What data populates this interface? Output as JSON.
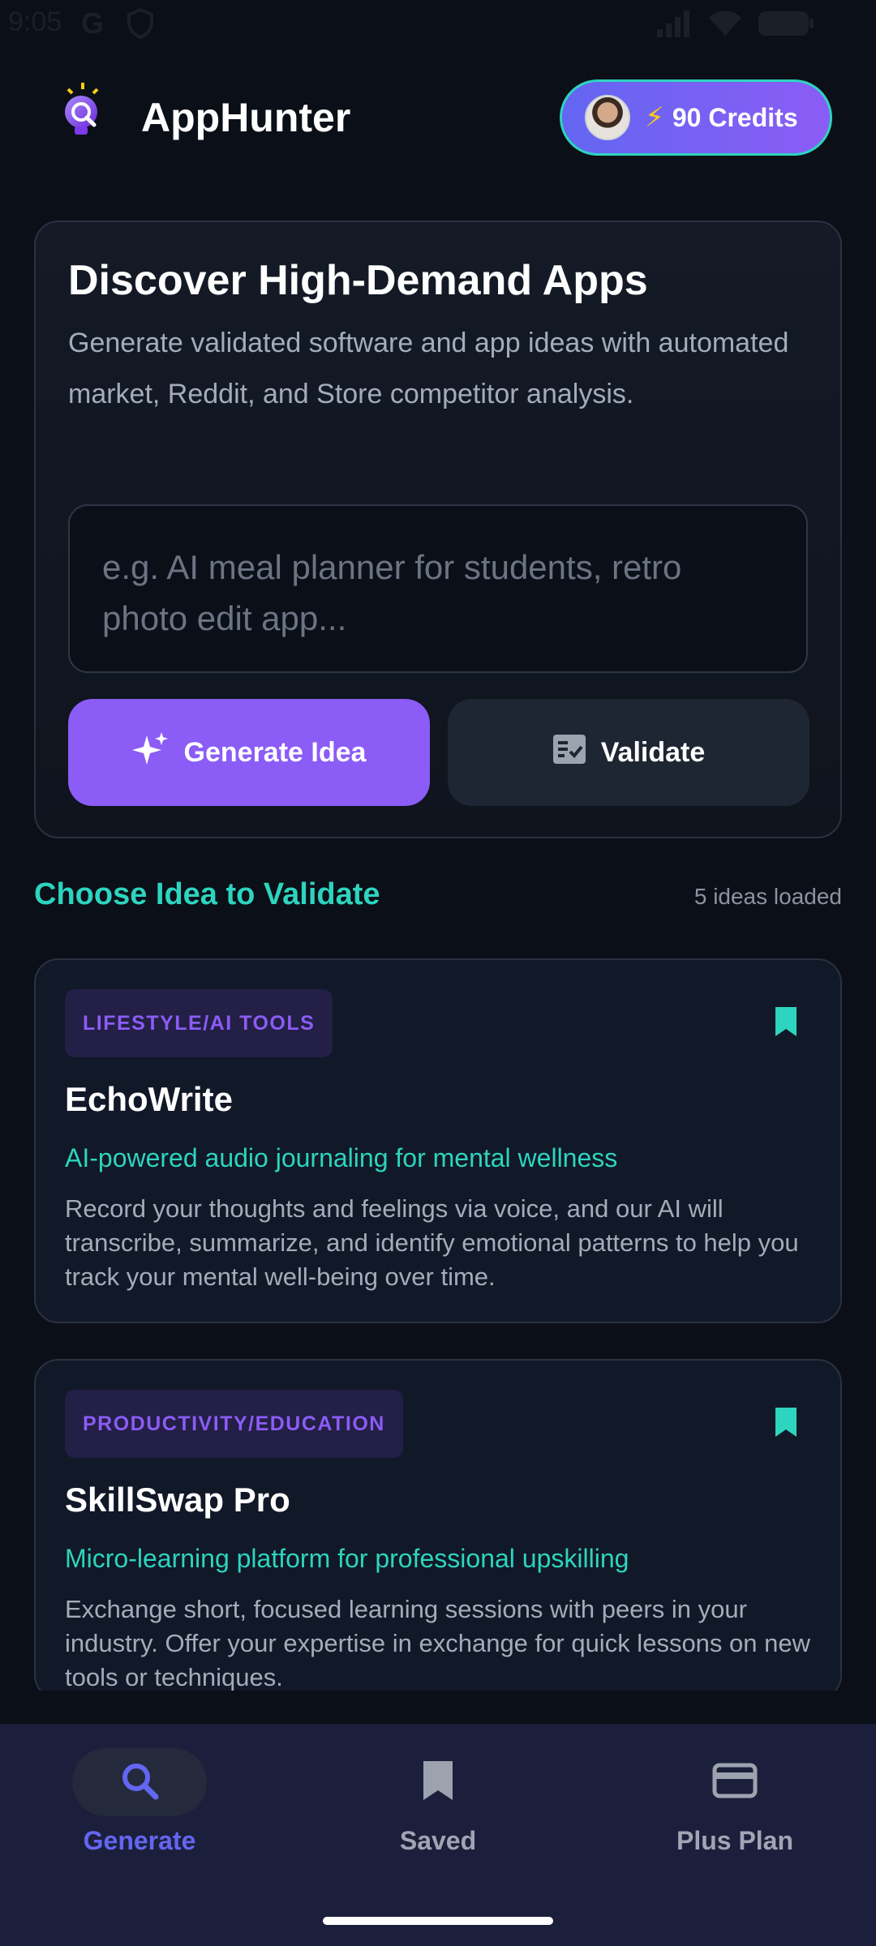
{
  "status_bar": {
    "time": "9:05",
    "carrier_icon": "G"
  },
  "header": {
    "app_title": "AppHunter",
    "credits_bolt": "⚡",
    "credits_label": "90 Credits"
  },
  "hero": {
    "title": "Discover High-Demand Apps",
    "description": "Generate validated software and app ideas with automated market, Reddit, and Store competitor analysis.",
    "input_placeholder": "e.g. AI meal planner for students, retro photo edit app...",
    "generate_label": "Generate Idea",
    "validate_label": "Validate"
  },
  "section": {
    "title": "Choose Idea to Validate",
    "count_label": "5 ideas loaded"
  },
  "ideas": [
    {
      "tag": "LIFESTYLE/AI TOOLS",
      "name": "EchoWrite",
      "tagline": "AI-powered audio journaling for mental wellness",
      "description": "Record your thoughts and feelings via voice, and our AI will transcribe, summarize, and identify emotional patterns to help you track your mental well-being over time."
    },
    {
      "tag": "PRODUCTIVITY/EDUCATION",
      "name": "SkillSwap Pro",
      "tagline": "Micro-learning platform for professional upskilling",
      "description": "Exchange short, focused learning sessions with peers in your industry. Offer your expertise in exchange for quick lessons on new tools or techniques."
    }
  ],
  "nav": {
    "items": [
      {
        "label": "Generate",
        "icon": "search-icon"
      },
      {
        "label": "Saved",
        "icon": "bookmark-icon"
      },
      {
        "label": "Plus Plan",
        "icon": "credit-card-icon"
      }
    ]
  },
  "colors": {
    "accent_purple": "#8b5cf6",
    "accent_teal": "#2dd4bf",
    "accent_indigo": "#6366f1",
    "background": "#0b0f17",
    "card": "#111827",
    "nav_background": "#1c1f3b"
  }
}
